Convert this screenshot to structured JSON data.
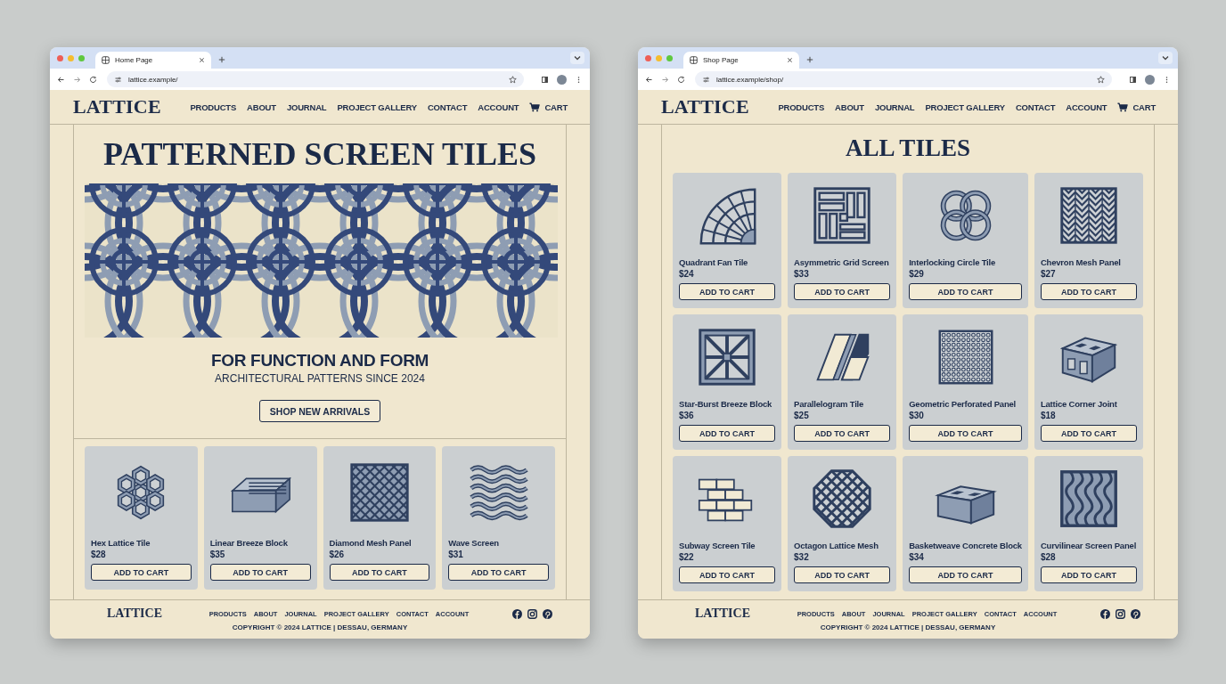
{
  "windows": [
    {
      "kind": "home",
      "tab": {
        "title": "Home Page",
        "selected": true
      },
      "url": "lattice.example/",
      "header": {
        "logo": "LATTICE",
        "nav": [
          "PRODUCTS",
          "ABOUT",
          "JOURNAL",
          "PROJECT GALLERY",
          "CONTACT",
          "ACCOUNT"
        ],
        "cart": "CART"
      },
      "hero": {
        "title": "PATTERNED SCREEN TILES",
        "tagline": "FOR FUNCTION AND FORM",
        "subtitle": "ARCHITECTURAL PATTERNS SINCE 2024",
        "button": "SHOP NEW ARRIVALS"
      },
      "products": [
        {
          "name": "Hex Lattice Tile",
          "price": "$28",
          "button": "ADD TO CART"
        },
        {
          "name": "Linear Breeze Block",
          "price": "$35",
          "button": "ADD TO CART"
        },
        {
          "name": "Diamond Mesh Panel",
          "price": "$26",
          "button": "ADD TO CART"
        },
        {
          "name": "Wave Screen",
          "price": "$31",
          "button": "ADD TO CART"
        }
      ],
      "footer": {
        "logo": "LATTICE",
        "links": [
          "PRODUCTS",
          "ABOUT",
          "JOURNAL",
          "PROJECT GALLERY",
          "CONTACT",
          "ACCOUNT"
        ],
        "copyright": "COPYRIGHT © 2024 LATTICE | DESSAU, GERMANY"
      }
    },
    {
      "kind": "shop",
      "tab": {
        "title": "Shop Page",
        "selected": true
      },
      "url": "lattice.example/shop/",
      "header": {
        "logo": "LATTICE",
        "nav": [
          "PRODUCTS",
          "ABOUT",
          "JOURNAL",
          "PROJECT GALLERY",
          "CONTACT",
          "ACCOUNT"
        ],
        "cart": "CART"
      },
      "heading": "ALL TILES",
      "products": [
        {
          "name": "Quadrant Fan Tile",
          "price": "$24",
          "button": "ADD TO CART"
        },
        {
          "name": "Asymmetric Grid Screen",
          "price": "$33",
          "button": "ADD TO CART"
        },
        {
          "name": "Interlocking Circle Tile",
          "price": "$29",
          "button": "ADD TO CART"
        },
        {
          "name": "Chevron Mesh Panel",
          "price": "$27",
          "button": "ADD TO CART"
        },
        {
          "name": "Star-Burst Breeze Block",
          "price": "$36",
          "button": "ADD TO CART"
        },
        {
          "name": "Parallelogram Tile",
          "price": "$25",
          "button": "ADD TO CART"
        },
        {
          "name": "Geometric Perforated Panel",
          "price": "$30",
          "button": "ADD TO CART"
        },
        {
          "name": "Lattice Corner Joint",
          "price": "$18",
          "button": "ADD TO CART"
        },
        {
          "name": "Subway Screen Tile",
          "price": "$22",
          "button": "ADD TO CART"
        },
        {
          "name": "Octagon Lattice Mesh",
          "price": "$32",
          "button": "ADD TO CART"
        },
        {
          "name": "Basketweave Concrete Block",
          "price": "$34",
          "button": "ADD TO CART"
        },
        {
          "name": "Curvilinear Screen Panel",
          "price": "$28",
          "button": "ADD TO CART"
        }
      ],
      "footer": {
        "logo": "LATTICE",
        "links": [
          "PRODUCTS",
          "ABOUT",
          "JOURNAL",
          "PROJECT GALLERY",
          "CONTACT",
          "ACCOUNT"
        ],
        "copyright": "COPYRIGHT © 2024 LATTICE | DESSAU, GERMANY"
      }
    }
  ]
}
